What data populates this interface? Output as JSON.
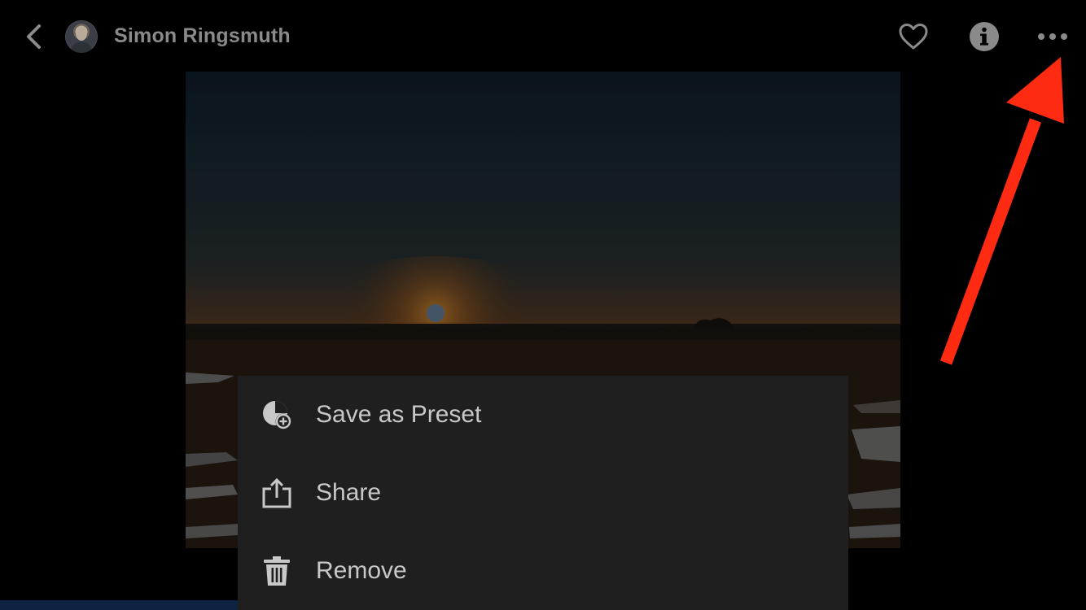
{
  "header": {
    "user_name": "Simon Ringsmuth",
    "icons": {
      "back": "chevron-left-icon",
      "favorite": "heart-icon",
      "info": "info-icon",
      "more": "ellipsis-icon"
    }
  },
  "menu": {
    "items": [
      {
        "label": "Save as Preset",
        "icon": "preset-add-icon"
      },
      {
        "label": "Share",
        "icon": "share-icon"
      },
      {
        "label": "Remove",
        "icon": "trash-icon"
      }
    ]
  },
  "colors": {
    "background": "#000000",
    "menu_background": "#1f1f1f",
    "menu_text": "#c8c8c8",
    "header_text": "#8a8a8a",
    "annotation_arrow": "#ff2a12"
  }
}
